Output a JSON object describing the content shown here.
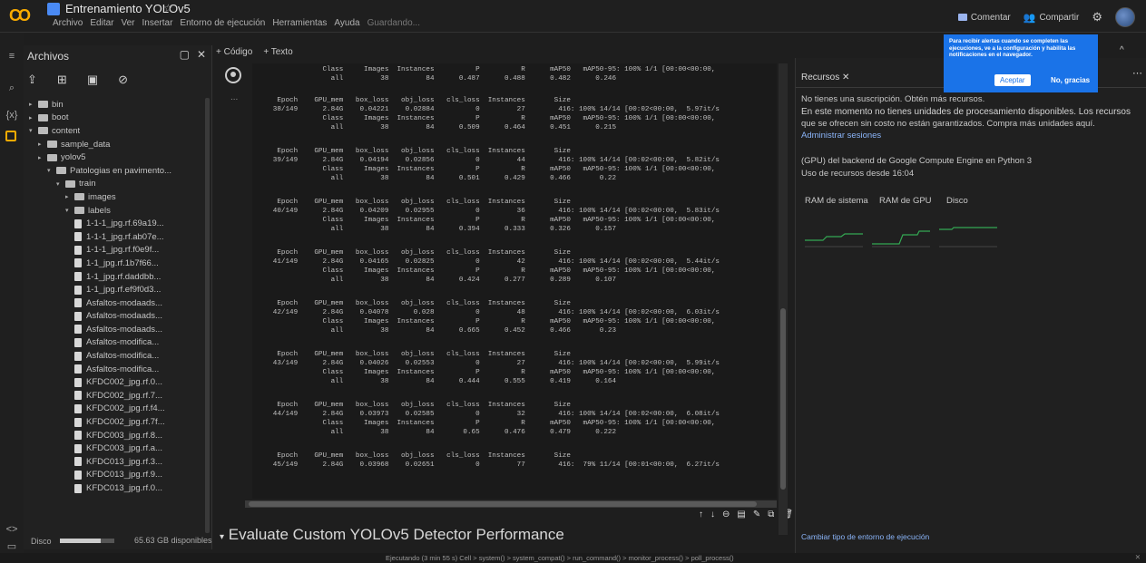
{
  "header": {
    "logo": "CO",
    "title": "Entrenamiento YOLOv5",
    "star": "☆",
    "menu": [
      "Archivo",
      "Editar",
      "Ver",
      "Insertar",
      "Entorno de ejecución",
      "Herramientas",
      "Ayuda"
    ],
    "saving": "Guardando...",
    "comment": "Comentar",
    "share": "Compartir"
  },
  "files": {
    "title": "Archivos",
    "tree": [
      {
        "label": "bin",
        "type": "folder",
        "depth": 0,
        "arrow": "▸"
      },
      {
        "label": "boot",
        "type": "folder",
        "depth": 0,
        "arrow": "▸"
      },
      {
        "label": "content",
        "type": "folder",
        "depth": 0,
        "arrow": "▾"
      },
      {
        "label": "sample_data",
        "type": "folder",
        "depth": 1,
        "arrow": "▸"
      },
      {
        "label": "yolov5",
        "type": "folder",
        "depth": 1,
        "arrow": "▸"
      },
      {
        "label": "Patologias en pavimento...",
        "type": "folder",
        "depth": 2,
        "arrow": "▾"
      },
      {
        "label": "train",
        "type": "folder",
        "depth": 3,
        "arrow": "▾"
      },
      {
        "label": "images",
        "type": "folder",
        "depth": 4,
        "arrow": "▸"
      },
      {
        "label": "labels",
        "type": "folder",
        "depth": 4,
        "arrow": "▾"
      },
      {
        "label": "1-1-1_jpg.rf.69a19...",
        "type": "file",
        "depth": 5
      },
      {
        "label": "1-1-1_jpg.rf.ab07e...",
        "type": "file",
        "depth": 5
      },
      {
        "label": "1-1-1_jpg.rf.f0e9f...",
        "type": "file",
        "depth": 5
      },
      {
        "label": "1-1_jpg.rf.1b7f66...",
        "type": "file",
        "depth": 5
      },
      {
        "label": "1-1_jpg.rf.daddbb...",
        "type": "file",
        "depth": 5
      },
      {
        "label": "1-1_jpg.rf.ef9f0d3...",
        "type": "file",
        "depth": 5
      },
      {
        "label": "Asfaltos-modaads...",
        "type": "file",
        "depth": 5
      },
      {
        "label": "Asfaltos-modaads...",
        "type": "file",
        "depth": 5
      },
      {
        "label": "Asfaltos-modaads...",
        "type": "file",
        "depth": 5
      },
      {
        "label": "Asfaltos-modifica...",
        "type": "file",
        "depth": 5
      },
      {
        "label": "Asfaltos-modifica...",
        "type": "file",
        "depth": 5
      },
      {
        "label": "Asfaltos-modifica...",
        "type": "file",
        "depth": 5
      },
      {
        "label": "KFDC002_jpg.rf.0...",
        "type": "file",
        "depth": 5
      },
      {
        "label": "KFDC002_jpg.rf.7...",
        "type": "file",
        "depth": 5
      },
      {
        "label": "KFDC002_jpg.rf.f4...",
        "type": "file",
        "depth": 5
      },
      {
        "label": "KFDC002_jpg.rf.7f...",
        "type": "file",
        "depth": 5
      },
      {
        "label": "KFDC003_jpg.rf.8...",
        "type": "file",
        "depth": 5
      },
      {
        "label": "KFDC003_jpg.rf.a...",
        "type": "file",
        "depth": 5
      },
      {
        "label": "KFDC013_jpg.rf.3...",
        "type": "file",
        "depth": 5
      },
      {
        "label": "KFDC013_jpg.rf.9...",
        "type": "file",
        "depth": 5
      },
      {
        "label": "KFDC013_jpg.rf.0...",
        "type": "file",
        "depth": 5
      }
    ],
    "disk_label": "Disco",
    "disk_fill": 0.75,
    "disk_value": "65.63 GB disponibles"
  },
  "toolbar": {
    "code": "+ Código",
    "text": "+ Texto"
  },
  "output": {
    "ellipsis": "...",
    "top_lines": [
      "                 Class     Images  Instances          P          R      mAP50   mAP50-95: 100% 1/1 [00:00<00:00,",
      "                   all         38         84      0.487      0.488      0.482      0.246"
    ],
    "epochs": [
      {
        "header": "      Epoch    GPU_mem   box_loss   obj_loss   cls_loss  Instances       Size",
        "train": "     38/149      2.84G    0.04221    0.02884          0         27        416: 100% 14/14 [00:02<00:00,  5.97it/s",
        "cls": "                 Class     Images  Instances          P          R      mAP50   mAP50-95: 100% 1/1 [00:00<00:00,",
        "all": "                   all         38         84      0.509      0.464      0.451      0.215"
      },
      {
        "header": "      Epoch    GPU_mem   box_loss   obj_loss   cls_loss  Instances       Size",
        "train": "     39/149      2.84G    0.04194    0.02856          0         44        416: 100% 14/14 [00:02<00:00,  5.82it/s",
        "cls": "                 Class     Images  Instances          P          R      mAP50   mAP50-95: 100% 1/1 [00:00<00:00,",
        "all": "                   all         38         84      0.501      0.429      0.466       0.22"
      },
      {
        "header": "      Epoch    GPU_mem   box_loss   obj_loss   cls_loss  Instances       Size",
        "train": "     40/149      2.84G    0.04209    0.02955          0         36        416: 100% 14/14 [00:02<00:00,  5.83it/s",
        "cls": "                 Class     Images  Instances          P          R      mAP50   mAP50-95: 100% 1/1 [00:00<00:00,",
        "all": "                   all         38         84      0.394      0.333      0.326      0.157"
      },
      {
        "header": "      Epoch    GPU_mem   box_loss   obj_loss   cls_loss  Instances       Size",
        "train": "     41/149      2.84G    0.04165    0.02825          0         42        416: 100% 14/14 [00:02<00:00,  5.44it/s",
        "cls": "                 Class     Images  Instances          P          R      mAP50   mAP50-95: 100% 1/1 [00:00<00:00,",
        "all": "                   all         38         84      0.424      0.277      0.289      0.107"
      },
      {
        "header": "      Epoch    GPU_mem   box_loss   obj_loss   cls_loss  Instances       Size",
        "train": "     42/149      2.84G    0.04078      0.028          0         48        416: 100% 14/14 [00:02<00:00,  6.03it/s",
        "cls": "                 Class     Images  Instances          P          R      mAP50   mAP50-95: 100% 1/1 [00:00<00:00,",
        "all": "                   all         38         84      0.665      0.452      0.466       0.23"
      },
      {
        "header": "      Epoch    GPU_mem   box_loss   obj_loss   cls_loss  Instances       Size",
        "train": "     43/149      2.84G    0.04026    0.02553          0         27        416: 100% 14/14 [00:02<00:00,  5.99it/s",
        "cls": "                 Class     Images  Instances          P          R      mAP50   mAP50-95: 100% 1/1 [00:00<00:00,",
        "all": "                   all         38         84      0.444      0.555      0.419      0.164"
      },
      {
        "header": "      Epoch    GPU_mem   box_loss   obj_loss   cls_loss  Instances       Size",
        "train": "     44/149      2.84G    0.03973    0.02585          0         32        416: 100% 14/14 [00:02<00:00,  6.08it/s",
        "cls": "                 Class     Images  Instances          P          R      mAP50   mAP50-95: 100% 1/1 [00:00<00:00,",
        "all": "                   all         38         84       0.65      0.476      0.479      0.222"
      },
      {
        "header": "      Epoch    GPU_mem   box_loss   obj_loss   cls_loss  Instances       Size",
        "train": "     45/149      2.84G    0.03968    0.02651          0         77        416:  79% 11/14 [00:01<00:00,  6.27it/s",
        "cls": "",
        "all": ""
      }
    ]
  },
  "section_title": "Evaluate Custom YOLOv5 Detector Performance",
  "status": {
    "text": "Ejecutando (3 min 55 s)   Cell > system() > system_compat() > run_command() > monitor_process() > poll_process()",
    "close": "✕"
  },
  "resources": {
    "tab": "Recursos ✕",
    "no_sub": "No tienes una suscripción. Obtén más recursos.",
    "units_1": "En este momento no tienes unidades de procesamiento disponibles. Los recursos",
    "units_2": "que se ofrecen sin costo no están garantizados. Compra más unidades aquí.",
    "manage": "Administrar sesiones",
    "backend": "(GPU) del backend de Google Compute Engine en Python 3",
    "since": "Uso de recursos desde 16:04",
    "gauges": [
      "RAM de sistema",
      "RAM de GPU",
      "Disco"
    ],
    "change": "Cambiar tipo de entorno de ejecución"
  },
  "popup": {
    "text": "Para recibir alertas cuando se completen las ejecuciones, ve a la configuración y habilita las notificaciones en el navegador.",
    "accept": "Aceptar",
    "decline": "No, gracias"
  }
}
